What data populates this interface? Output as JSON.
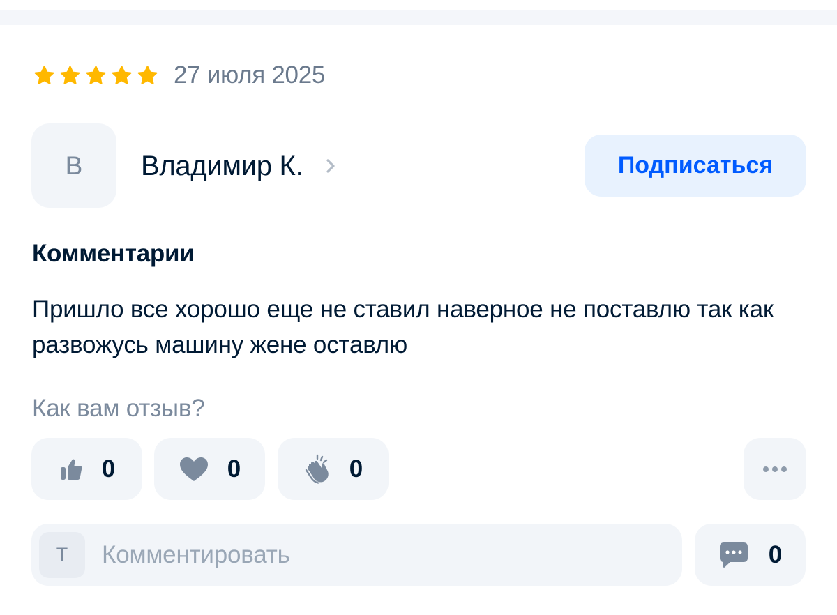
{
  "review": {
    "rating": 5,
    "rating_max": 5,
    "date": "27 июля 2025",
    "star_color": "#ffb800"
  },
  "author": {
    "avatar_letter": "В",
    "name": "Владимир К.",
    "chevron_icon": "chevron-right-icon"
  },
  "subscribe_button": {
    "label": "Подписаться",
    "color": "#005bff"
  },
  "comment_section": {
    "title": "Комментарии",
    "text": "Пришло все хорошо еще не ставил наверное не поставлю так как развожусь машину жене оставлю"
  },
  "feedback": {
    "question": "Как вам отзыв?",
    "reactions": [
      {
        "icon": "thumbs-up-icon",
        "count": "0"
      },
      {
        "icon": "heart-icon",
        "count": "0"
      },
      {
        "icon": "clapping-hands-icon",
        "count": "0"
      }
    ],
    "more_icon": "more-dots-icon"
  },
  "comment_input": {
    "avatar_letter": "Т",
    "placeholder": "Комментировать"
  },
  "comments_count": {
    "icon": "chat-bubble-icon",
    "count": "0"
  }
}
